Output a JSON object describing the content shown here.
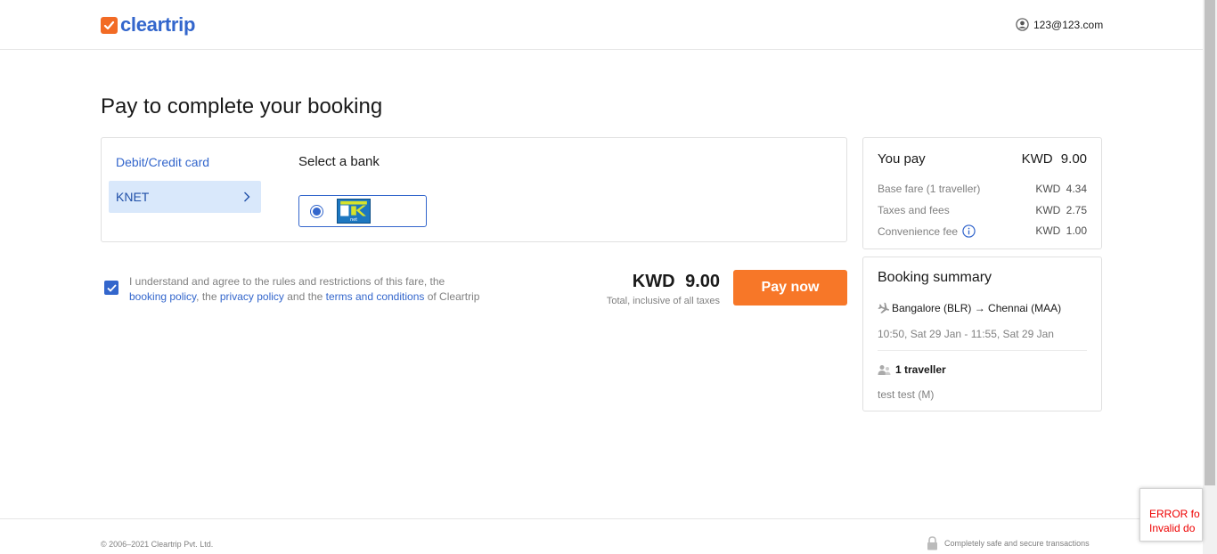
{
  "header": {
    "logo_text": "cleartrip",
    "user_email": "123@123.com"
  },
  "page_title": "Pay to complete your booking",
  "payment": {
    "method_label": "Debit/Credit card",
    "selected_method": "KNET",
    "bank_title": "Select a bank",
    "bank_logo_text": "net"
  },
  "agreement": {
    "text_1": "I understand and agree to the rules and restrictions of this fare, the",
    "link_booking_policy": "booking policy",
    "text_2": ", the",
    "link_privacy_policy": "privacy policy",
    "text_3": "and the",
    "link_terms": "terms and conditions",
    "text_4": "of Cleartrip",
    "checked": true
  },
  "total": {
    "amount": "KWD 9.00",
    "subtext": "Total, inclusive of all taxes",
    "pay_button": "Pay now"
  },
  "you_pay": {
    "label": "You pay",
    "amount": "KWD 9.00",
    "rows": [
      {
        "label": "Base fare (1 traveller)",
        "value": "KWD 4.34"
      },
      {
        "label": "Taxes and fees",
        "value": "KWD 2.75"
      },
      {
        "label": "Convenience fee",
        "value": "KWD 1.00"
      }
    ]
  },
  "booking_summary": {
    "title": "Booking summary",
    "route": "Bangalore (BLR) → Chennai (MAA)",
    "times": "10:50, Sat 29 Jan - 11:55, Sat 29 Jan",
    "travellers": "1 traveller",
    "traveller_name": "test test (M)"
  },
  "footer": {
    "copyright": "© 2006–2021 Cleartrip Pvt. Ltd.",
    "secure_text": "Completely safe and secure transactions"
  },
  "recaptcha": {
    "line1": "ERROR fo",
    "line2": "Invalid do"
  },
  "colors": {
    "brand_blue": "#3366cc",
    "brand_orange": "#f77728",
    "selected_bg": "#d9e8fb"
  }
}
